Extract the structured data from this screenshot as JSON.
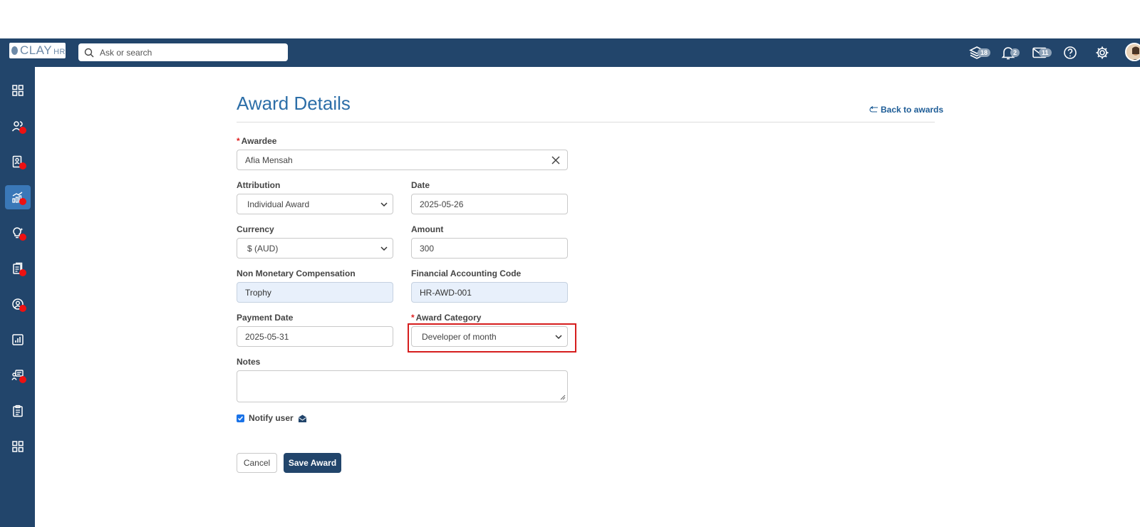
{
  "app": {
    "logo_text": "CLAY",
    "logo_suffix": "HR"
  },
  "search": {
    "placeholder": "Ask or search"
  },
  "topbar": {
    "badges": {
      "layers": "18",
      "notifications": "2",
      "messages": "11"
    },
    "icons": [
      "layers-icon",
      "bell-icon",
      "mail-icon",
      "help-icon",
      "gear-icon",
      "avatar"
    ]
  },
  "sidebar": {
    "items": [
      {
        "icon": "dashboard-grid-icon",
        "active": false,
        "alert": false
      },
      {
        "icon": "people-icon",
        "active": false,
        "alert": true
      },
      {
        "icon": "id-card-icon",
        "active": false,
        "alert": true
      },
      {
        "icon": "growth-chart-icon",
        "active": true,
        "alert": true
      },
      {
        "icon": "lightbulb-icon",
        "active": false,
        "alert": true
      },
      {
        "icon": "documents-icon",
        "active": false,
        "alert": true
      },
      {
        "icon": "user-circle-icon",
        "active": false,
        "alert": true
      },
      {
        "icon": "report-chart-icon",
        "active": false,
        "alert": false
      },
      {
        "icon": "team-board-icon",
        "active": false,
        "alert": true
      },
      {
        "icon": "clipboard-icon",
        "active": false,
        "alert": false
      },
      {
        "icon": "apps-grid-icon",
        "active": false,
        "alert": false
      }
    ]
  },
  "page": {
    "title": "Award Details",
    "back_link": "Back to awards"
  },
  "form": {
    "awardee": {
      "label": "Awardee",
      "value": "Afia Mensah",
      "required": true
    },
    "attribution": {
      "label": "Attribution",
      "value": "Individual Award"
    },
    "date": {
      "label": "Date",
      "value": "2025-05-26"
    },
    "currency": {
      "label": "Currency",
      "value": "$ (AUD)"
    },
    "amount": {
      "label": "Amount",
      "value": "300"
    },
    "non_monetary": {
      "label": "Non Monetary Compensation",
      "value": "Trophy"
    },
    "accounting_code": {
      "label": "Financial Accounting Code",
      "value": "HR-AWD-001"
    },
    "payment_date": {
      "label": "Payment Date",
      "value": "2025-05-31"
    },
    "award_category": {
      "label": "Award Category",
      "value": "Developer of month",
      "required": true
    },
    "notes": {
      "label": "Notes",
      "value": ""
    },
    "notify_user": {
      "label": "Notify user",
      "checked": true
    }
  },
  "buttons": {
    "cancel": "Cancel",
    "save": "Save Award"
  },
  "colors": {
    "topbar": "#22456b",
    "accent": "#2c6ea8",
    "highlight": "#d61d1d",
    "required": "#e02020"
  }
}
